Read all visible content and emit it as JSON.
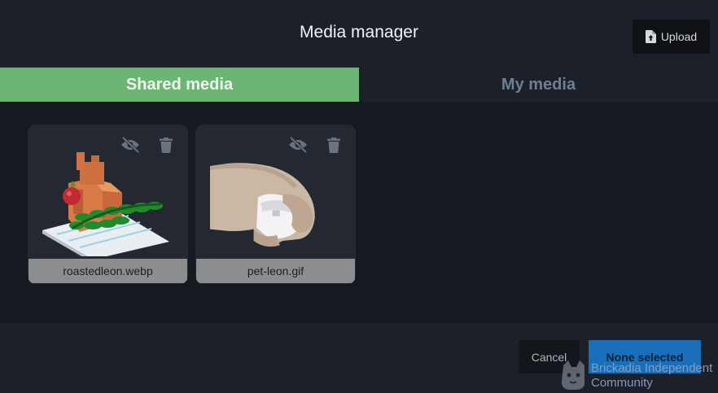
{
  "header": {
    "title": "Media manager",
    "upload_label": "Upload"
  },
  "tabs": [
    {
      "label": "Shared media",
      "active": true
    },
    {
      "label": "My media",
      "active": false
    }
  ],
  "media": [
    {
      "filename": "roastedleon.webp",
      "hidden_icon": "eye-off-icon",
      "delete_icon": "trash-icon"
    },
    {
      "filename": "pet-leon.gif",
      "hidden_icon": "eye-off-icon",
      "delete_icon": "trash-icon"
    }
  ],
  "footer": {
    "cancel_label": "Cancel",
    "select_label": "None selected"
  },
  "watermark": {
    "line1": "Brickadia Independent",
    "line2": "Community"
  },
  "colors": {
    "active_tab": "#6db575",
    "primary_button": "#1a6fbb",
    "background": "#1c2028"
  }
}
